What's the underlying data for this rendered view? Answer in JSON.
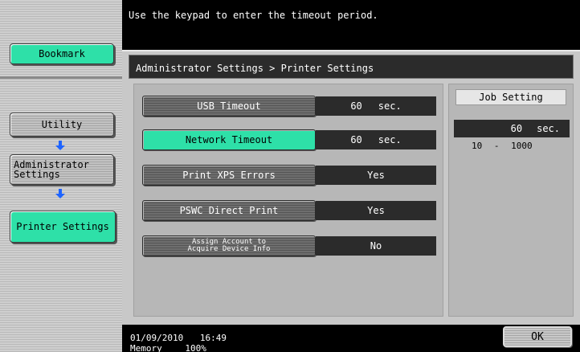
{
  "message": "Use the keypad to enter the timeout period.",
  "sidebar": {
    "bookmark_label": "Bookmark",
    "utility_label": "Utility",
    "admin_label": "Administrator Settings",
    "printer_label": "Printer Settings"
  },
  "breadcrumb": "Administrator Settings > Printer Settings",
  "settings": [
    {
      "label": "USB Timeout",
      "value": "60",
      "unit": "sec."
    },
    {
      "label": "Network Timeout",
      "value": "60",
      "unit": "sec."
    },
    {
      "label": "Print XPS Errors",
      "value": "Yes",
      "unit": ""
    },
    {
      "label": "PSWC Direct Print",
      "value": "Yes",
      "unit": ""
    },
    {
      "label": "Assign Account to Acquire Device Info",
      "value": "No",
      "unit": ""
    }
  ],
  "job_setting": {
    "title": "Job Setting",
    "value": "60",
    "unit": "sec.",
    "range_min": "10",
    "range_sep": "-",
    "range_max": "1000"
  },
  "footer": {
    "date": "01/09/2010",
    "time": "16:49",
    "memory_label": "Memory",
    "memory_value": "100%",
    "ok_label": "OK"
  },
  "colors": {
    "accent": "#2ee0a8",
    "arrow": "#1e64ff"
  }
}
